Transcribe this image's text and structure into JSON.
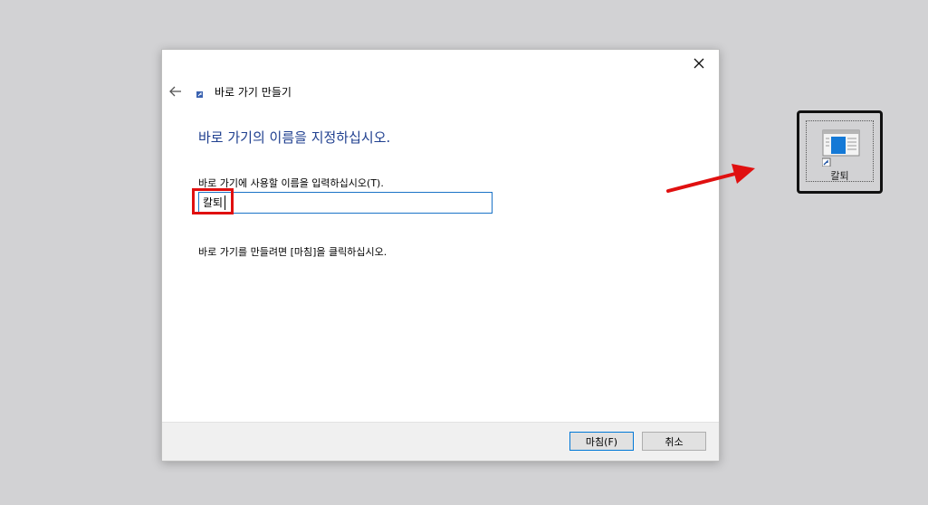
{
  "wizard": {
    "title": "바로 가기 만들기",
    "heading": "바로 가기의 이름을 지정하십시오.",
    "field_label": "바로 가기에 사용할 이름을 입력하십시오(T).",
    "name_value": "칼퇴",
    "instruction": "바로 가기를 만들려면 [마침]을 클릭하십시오.",
    "finish_label": "마침(F)",
    "cancel_label": "취소"
  },
  "desktop": {
    "shortcut_label": "칼퇴"
  },
  "colors": {
    "heading": "#1f3f8f",
    "input_border": "#1a73c7",
    "annotation_red": "#e01010"
  },
  "icons": [
    "close-icon",
    "back-arrow-icon",
    "shortcut-wizard-icon",
    "shortcut-icon",
    "red-arrow-annotation"
  ]
}
